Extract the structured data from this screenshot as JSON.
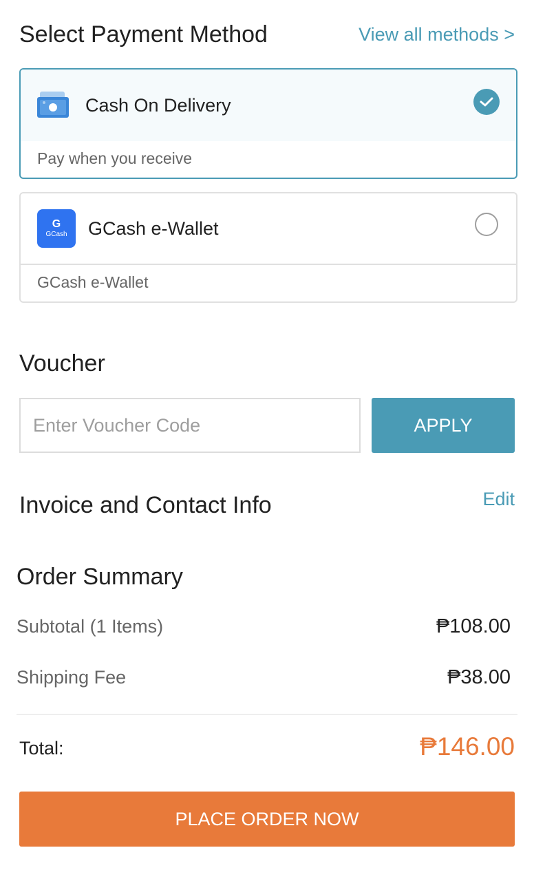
{
  "payment": {
    "title": "Select Payment Method",
    "view_all": "View all methods >",
    "methods": [
      {
        "name": "Cash On Delivery",
        "subtitle": "Pay when you receive",
        "selected": true,
        "icon": "cash-icon"
      },
      {
        "name": "GCash e-Wallet",
        "subtitle": "GCash e-Wallet",
        "selected": false,
        "icon": "gcash-logo-icon",
        "icon_text": "GCash",
        "icon_letter": "G"
      }
    ]
  },
  "voucher": {
    "title": "Voucher",
    "placeholder": "Enter Voucher Code",
    "apply_label": "APPLY"
  },
  "invoice": {
    "title": "Invoice and Contact Info",
    "edit_label": "Edit"
  },
  "summary": {
    "title": "Order Summary",
    "subtotal_label": "Subtotal (1 Items)",
    "subtotal_value": "₱108.00",
    "shipping_label": "Shipping Fee",
    "shipping_value": "₱38.00",
    "total_label": "Total:",
    "total_value": "₱146.00"
  },
  "place_order_label": "PLACE ORDER NOW",
  "colors": {
    "accent": "#4a9bb5",
    "primary_button": "#e87a3a",
    "total": "#e87a3a"
  }
}
